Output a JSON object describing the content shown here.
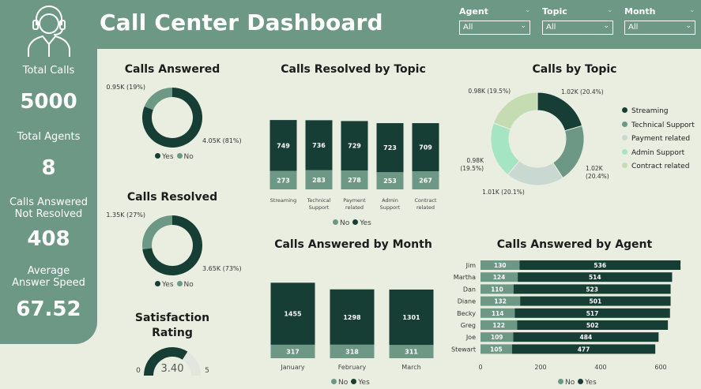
{
  "header": {
    "title": "Call Center Dashboard"
  },
  "filters": [
    {
      "label": "Agent",
      "value": "All"
    },
    {
      "label": "Topic",
      "value": "All"
    },
    {
      "label": "Month",
      "value": "All"
    }
  ],
  "kpis": [
    {
      "label": "Total Calls",
      "value": "5000"
    },
    {
      "label": "Total Agents",
      "value": "8"
    },
    {
      "label": "Calls Answered Not Resolved",
      "value": "408"
    },
    {
      "label": "Average Answer Speed",
      "value": "67.52"
    }
  ],
  "colors": {
    "dark": "#173e34",
    "mid": "#6e9886",
    "light": "#c5dcb3",
    "mint": "#a5e5c4",
    "grey": "#c9d9d2"
  },
  "legends": {
    "yes": "Yes",
    "no": "No"
  },
  "chart_data": [
    {
      "id": "calls-answered",
      "type": "pie",
      "title": "Calls Answered",
      "labels": [
        "Yes",
        "No"
      ],
      "values": [
        4054,
        946
      ],
      "data_labels": [
        "4.05K (81%)",
        "0.95K (19%)"
      ]
    },
    {
      "id": "calls-resolved",
      "type": "pie",
      "title": "Calls Resolved",
      "labels": [
        "Yes",
        "No"
      ],
      "values": [
        3646,
        1354
      ],
      "data_labels": [
        "3.65K (73%)",
        "1.35K (27%)"
      ]
    },
    {
      "id": "satisfaction",
      "type": "gauge",
      "title": "Satisfaction Rating",
      "value": 3.4,
      "value_label": "3.40",
      "min": 0,
      "max": 5,
      "min_label": "0",
      "max_label": "5"
    },
    {
      "id": "resolved-by-topic",
      "type": "bar",
      "stacked": true,
      "title": "Calls Resolved by Topic",
      "categories": [
        "Streaming",
        "Technical Support",
        "Payment related",
        "Admin Support",
        "Contract related"
      ],
      "category_lines": [
        [
          "Streaming"
        ],
        [
          "Technical",
          "Support"
        ],
        [
          "Payment",
          "related"
        ],
        [
          "Admin",
          "Support"
        ],
        [
          "Contract",
          "related"
        ]
      ],
      "series": [
        {
          "name": "No",
          "values": [
            273,
            283,
            278,
            253,
            267
          ]
        },
        {
          "name": "Yes",
          "values": [
            749,
            736,
            729,
            723,
            709
          ]
        }
      ]
    },
    {
      "id": "by-topic",
      "type": "pie",
      "title": "Calls by Topic",
      "labels": [
        "Streaming",
        "Technical Support",
        "Payment related",
        "Admin Support",
        "Contract related"
      ],
      "values": [
        1022,
        1019,
        1007,
        977,
        975
      ],
      "data_labels": [
        "1.02K (20.4%)",
        "1.02K (20.4%)",
        "1.01K (20.1%)",
        "0.98K (19.5%)",
        "0.98K (19.5%)"
      ]
    },
    {
      "id": "answered-by-month",
      "type": "bar",
      "stacked": true,
      "title": "Calls Answered by Month",
      "categories": [
        "January",
        "February",
        "March"
      ],
      "series": [
        {
          "name": "No",
          "values": [
            317,
            318,
            311
          ]
        },
        {
          "name": "Yes",
          "values": [
            1455,
            1298,
            1301
          ]
        }
      ]
    },
    {
      "id": "answered-by-agent",
      "type": "bar",
      "orientation": "horizontal",
      "stacked": true,
      "title": "Calls Answered by Agent",
      "categories": [
        "Jim",
        "Martha",
        "Dan",
        "Diane",
        "Becky",
        "Greg",
        "Joe",
        "Stewart"
      ],
      "series": [
        {
          "name": "No",
          "values": [
            130,
            124,
            110,
            132,
            114,
            122,
            109,
            105
          ]
        },
        {
          "name": "Yes",
          "values": [
            536,
            514,
            523,
            501,
            517,
            502,
            484,
            477
          ]
        }
      ],
      "x_ticks": [
        "0",
        "200",
        "400",
        "600"
      ],
      "xlim": [
        0,
        600
      ]
    }
  ]
}
